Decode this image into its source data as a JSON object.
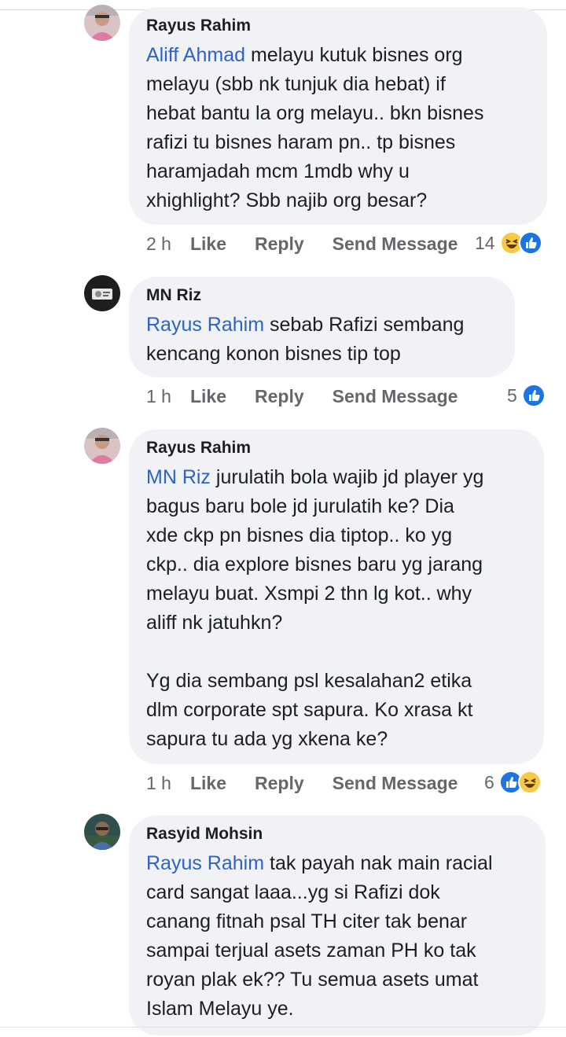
{
  "comments": [
    {
      "author": "Rayus Rahim",
      "mention": "Aliff Ahmad",
      "lines": [
        " melayu kutuk bisnes org",
        "melayu (sbb nk tunjuk dia hebat) if",
        "hebat bantu la org melayu.. bkn bisnes",
        "rafizi tu bisnes haram pn.. tp bisnes",
        "haramjadah mcm 1mdb why u",
        "xhighlight? Sbb najib org besar?"
      ],
      "time": "2 h",
      "like_label": "Like",
      "reply_label": "Reply",
      "message_label": "Send Message",
      "reaction_count": "14",
      "reactions": [
        "haha-icon",
        "like-icon"
      ]
    },
    {
      "author": "MN Riz",
      "mention": "Rayus Rahim",
      "lines": [
        " sebab Rafizi sembang",
        "kencang konon bisnes tip top"
      ],
      "time": "1 h",
      "like_label": "Like",
      "reply_label": "Reply",
      "message_label": "Send Message",
      "reaction_count": "5",
      "reactions": [
        "like-icon"
      ]
    },
    {
      "author": "Rayus Rahim",
      "mention": "MN Riz",
      "lines": [
        " jurulatih bola wajib jd player yg",
        "bagus baru bole jd jurulatih ke? Dia",
        "xde ckp pn bisnes dia tiptop.. ko yg",
        "ckp.. dia explore bisnes baru yg jarang",
        "melayu buat. Xsmpi 2 thn lg kot.. why",
        "aliff nk jatuhkn?"
      ],
      "lines2": [
        "Yg dia sembang psl kesalahan2 etika",
        "dlm corporate spt sapura.  Ko xrasa kt",
        "sapura tu ada yg xkena ke?"
      ],
      "time": "1 h",
      "like_label": "Like",
      "reply_label": "Reply",
      "message_label": "Send Message",
      "reaction_count": "6",
      "reactions": [
        "like-icon",
        "haha-icon"
      ]
    },
    {
      "author": "Rasyid Mohsin",
      "mention": "Rayus Rahim",
      "lines": [
        " tak payah nak main racial",
        "card sangat laaa...yg si Rafizi dok",
        "canang fitnah psal TH citer tak benar",
        "sampai terjual asets zaman PH ko tak",
        "royan plak ek?? Tu semua asets umat",
        "Islam Melayu ye."
      ]
    }
  ],
  "colors": {
    "bubble": "#f0f2f5",
    "mention": "#2d63c8",
    "meta": "#65676b",
    "like_blue": "#1b74e4",
    "haha_yellow": "#f7c948"
  }
}
